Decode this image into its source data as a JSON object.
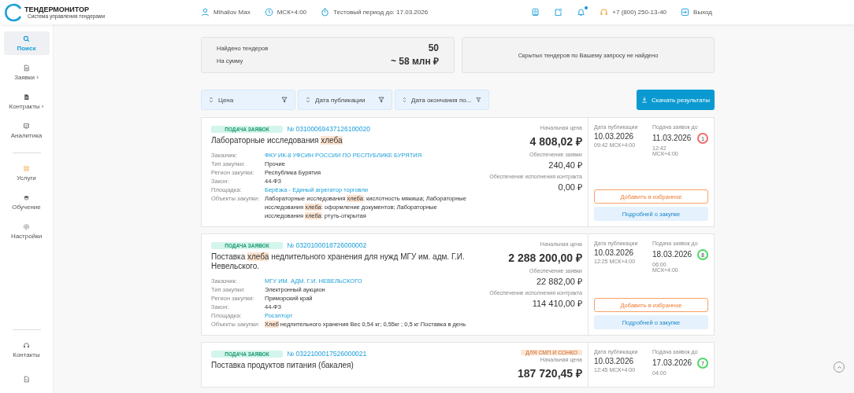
{
  "header": {
    "logo_title": "ТЕНДЕРМОНИТОР",
    "logo_subtitle": "Система управления тендерами",
    "user": "Mihailov Max",
    "timezone": "МСК+4:00",
    "trial": "Тестовый период до: 17.03.2026",
    "notifications_unread": true,
    "phone": "+7 (800) 250-13-40",
    "logout": "Выход"
  },
  "sidebar": {
    "items": [
      {
        "kind": "search",
        "label": "Поиск",
        "selected": true
      },
      {
        "kind": "requests",
        "label": "Заявки ›",
        "selected": false
      },
      {
        "kind": "contracts",
        "label": "Контракты ›",
        "selected": false
      },
      {
        "kind": "analytics",
        "label": "Аналитика",
        "selected": false
      },
      {
        "kind": "services",
        "label": "Услуги",
        "selected": false
      },
      {
        "kind": "learning",
        "label": "Обучение",
        "selected": false
      },
      {
        "kind": "settings",
        "label": "Настройки",
        "selected": false
      }
    ],
    "bottom_items": [
      {
        "kind": "contacts",
        "label": "Контакты"
      },
      {
        "kind": "document"
      }
    ]
  },
  "summary": {
    "found_label": "Найдено тендеров",
    "found_value": "50",
    "sum_label": "На сумму",
    "sum_value": "~ 58 млн ₽",
    "hidden_message": "Скрытых тендеров по Вашему запросу не найдено"
  },
  "sort_filters": [
    {
      "label": "Цена"
    },
    {
      "label": "Дата публикации"
    },
    {
      "label": "Дата окончания по..."
    }
  ],
  "download_button": "Скачать результаты",
  "tenders": [
    {
      "status": "ПОДАЧА ЗАЯВОК",
      "number": "№ 03100069437126100020",
      "title": "Лабораторные исследования **хлеба**",
      "details": [
        {
          "label": "Заказчик:",
          "value": "ФКУ ИК-8 УФСИН РОССИИ ПО РЕСПУБЛИКЕ БУРЯТИЯ",
          "link": true
        },
        {
          "label": "Тип закупки:",
          "value": "Прочие",
          "link": false
        },
        {
          "label": "Регион закупки:",
          "value": "Республика Бурятия",
          "link": false
        },
        {
          "label": "Закон:",
          "value": "44-ФЗ",
          "link": false
        },
        {
          "label": "Площадка:",
          "value": "Берёзка - Единый агрегатор торговли",
          "link": true
        },
        {
          "label": "Объекты закупки:",
          "value": "Лабораторные исследования **хлеба**: кислотность мякиша; Лабораторные исследования **хлеба**: оформление документов; Лабораторные исследования **хлеба**: ртуть-открытая",
          "link": false
        }
      ],
      "prices": [
        {
          "kind": "main",
          "label": "Начальная цена",
          "value": "4 808,02 ₽"
        },
        {
          "kind": "secondary",
          "label": "Обеспечение заявки",
          "value": "240,40 ₽"
        },
        {
          "kind": "secondary",
          "label": "Обеспечение исполнения контракта",
          "value": "0,00 ₽"
        }
      ],
      "published_label": "Дата публикации",
      "published_date": "10.03.2026",
      "published_time": "09:42 МСК+4:00",
      "deadline_label": "Подача заявок до",
      "deadline_date": "11.03.2026",
      "deadline_time": "12:42 МСК+4:00",
      "days_left": {
        "value": "1",
        "color": "#f06b6b"
      },
      "favorite_button": "Добавить в избранное",
      "details_button": "Подробней о закупке"
    },
    {
      "status": "ПОДАЧА ЗАЯВОК",
      "number": "№ 0320100018726000002",
      "title": "Поставка **хлеба** недлительного хранения для нужд МГУ им. адм. Г.И. Невельского.",
      "details": [
        {
          "label": "Заказчик:",
          "value": "МГУ ИМ. АДМ. Г.И. НЕВЕЛЬСКОГО",
          "link": true
        },
        {
          "label": "Тип закупки:",
          "value": "Электронный аукцион",
          "link": false
        },
        {
          "label": "Регион закупки:",
          "value": "Приморский край",
          "link": false
        },
        {
          "label": "Закон:",
          "value": "44-ФЗ",
          "link": false
        },
        {
          "label": "Площадка:",
          "value": "Росэлторг",
          "link": true
        },
        {
          "label": "Объекты закупки:",
          "value": "**Хлеб** недлительного хранения Вес 0,54 кг; 0,55кг ; 0,5 кг Поставка в день",
          "link": false
        }
      ],
      "prices": [
        {
          "kind": "main",
          "label": "Начальная цена",
          "value": "2 288 200,00 ₽"
        },
        {
          "kind": "secondary",
          "label": "Обеспечение заявки",
          "value": "22 882,00 ₽"
        },
        {
          "kind": "secondary",
          "label": "Обеспечение исполнения контракта",
          "value": "114 410,00 ₽"
        }
      ],
      "published_label": "Дата публикации",
      "published_date": "10.03.2026",
      "published_time": "12:25 МСК+4:00",
      "deadline_label": "Подача заявок до",
      "deadline_date": "18.03.2026",
      "deadline_time": "06:00 МСК+4:00",
      "days_left": {
        "value": "8",
        "color": "#4cd964"
      },
      "favorite_button": "Добавить в избранное",
      "details_button": "Подробней о закупке"
    },
    {
      "status": "ПОДАЧА ЗАЯВОК",
      "number": "№ 0322100017526000021",
      "title": "Поставка продуктов питания (бакалея)",
      "sme_badge": "ДЛЯ СМП И СОНКО",
      "prices": [
        {
          "kind": "main",
          "label": "Начальная цена",
          "value": "187 720,45 ₽"
        }
      ],
      "published_label": "Дата публикации",
      "published_date": "10.03.2026",
      "published_time": "12:45 МСК+4:00",
      "deadline_label": "Подача заявок до",
      "deadline_date": "17.03.2026",
      "deadline_time": "04:00",
      "days_left": {
        "value": "7",
        "color": "#4cd964"
      }
    }
  ]
}
